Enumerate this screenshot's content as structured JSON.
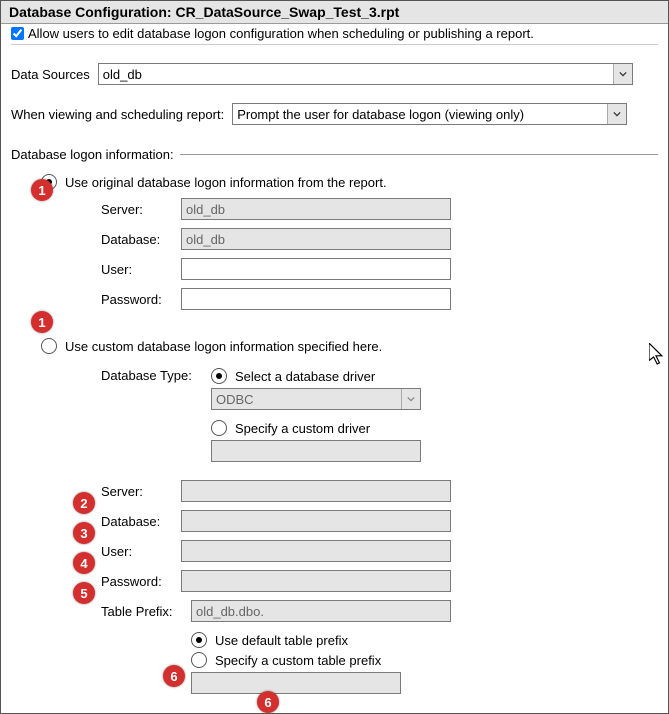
{
  "title": "Database Configuration: CR_DataSource_Swap_Test_3.rpt",
  "allow_label": "Allow users to edit database logon configuration when scheduling or publishing a report.",
  "allow_checked": true,
  "data_sources_label": "Data Sources",
  "data_sources_value": "old_db",
  "when_label": "When viewing and scheduling report:",
  "when_value": "Prompt the user for database logon (viewing only)",
  "logon_section": "Database logon information:",
  "opt_original": "Use original database logon information from the report.",
  "opt_custom": "Use custom database logon information specified here.",
  "orig": {
    "server_l": "Server:",
    "server_v": "old_db",
    "database_l": "Database:",
    "database_v": "old_db",
    "user_l": "User:",
    "user_v": "",
    "password_l": "Password:",
    "password_v": ""
  },
  "custom": {
    "dbtype_l": "Database Type:",
    "select_driver": "Select a database driver",
    "driver_value": "ODBC",
    "specify_driver": "Specify a custom driver",
    "server_l": "Server:",
    "database_l": "Database:",
    "user_l": "User:",
    "password_l": "Password:",
    "table_prefix_l": "Table Prefix:",
    "table_prefix_v": "old_db.dbo.",
    "use_default_prefix": "Use default table prefix",
    "specify_prefix": "Specify a custom table prefix"
  },
  "badges": {
    "b1": "1",
    "b1b": "1",
    "b2": "2",
    "b3": "3",
    "b4": "4",
    "b5": "5",
    "b6": "6",
    "b6b": "6"
  }
}
